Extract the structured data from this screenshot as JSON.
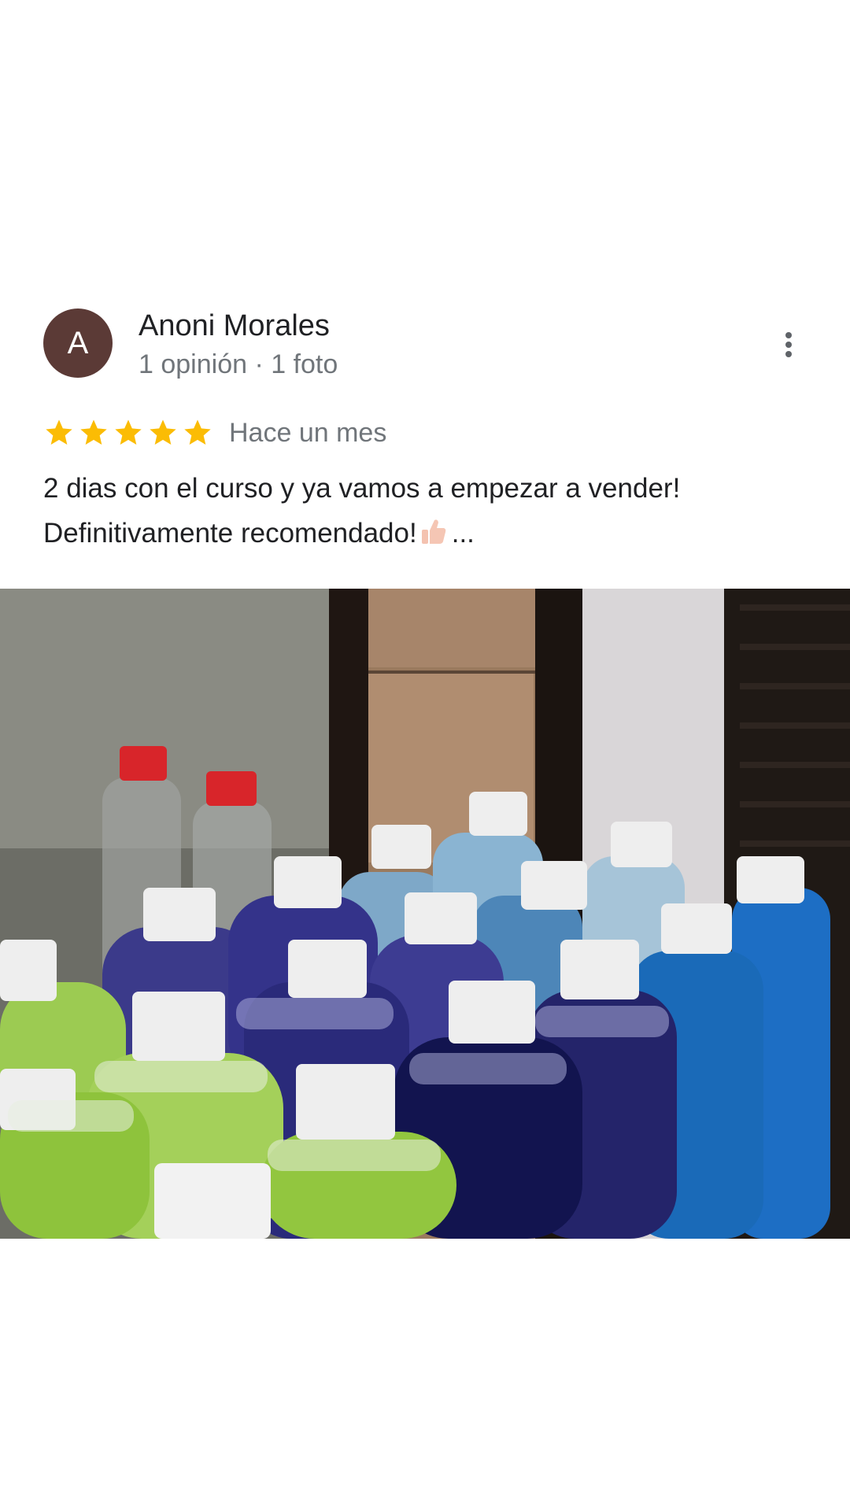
{
  "review": {
    "avatar_letter": "A",
    "avatar_color": "#5b3a36",
    "author_name": "Anoni Morales",
    "author_meta": "1 opinión · 1 foto",
    "rating": 5,
    "rating_max": 5,
    "star_color": "#fbbc04",
    "time": "Hace un mes",
    "text_line1": "2 dias con el curso y ya vamos a empezar a vender!",
    "text_line2": "Definitivamente recomendado!",
    "text_ellipsis": "...",
    "emoji": "thumbs-up-icon",
    "more_icon": "more-vert-icon"
  },
  "photo": {
    "subject_icon": "review-photo"
  }
}
